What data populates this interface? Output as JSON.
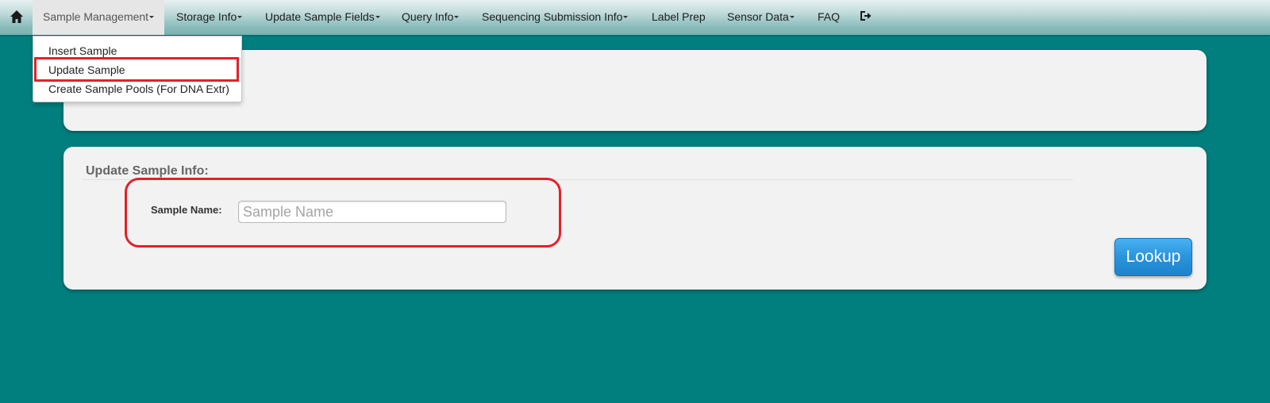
{
  "navbar": {
    "home_icon": "home-icon",
    "items": [
      {
        "label": "Sample Management",
        "has_caret": true,
        "active": true
      },
      {
        "label": "Storage Info",
        "has_caret": true
      },
      {
        "label": "Update Sample Fields",
        "has_caret": true
      },
      {
        "label": "Query Info",
        "has_caret": true
      },
      {
        "label": "Sequencing Submission Info",
        "has_caret": true
      },
      {
        "label": "Label Prep",
        "has_caret": false
      },
      {
        "label": "Sensor Data",
        "has_caret": true
      },
      {
        "label": "FAQ",
        "has_caret": false
      }
    ],
    "logout_icon": "logout-icon"
  },
  "dropdown": {
    "items": [
      {
        "label": "Insert Sample"
      },
      {
        "label": "Update Sample",
        "highlighted": true
      },
      {
        "label": "Create Sample Pools (For DNA Extr)"
      }
    ]
  },
  "update_panel": {
    "heading": "Update Sample Info:",
    "sample_name_label": "Sample Name:",
    "sample_name_value": "",
    "sample_name_placeholder": "Sample Name",
    "lookup_label": "Lookup"
  },
  "colors": {
    "background": "#017e7e",
    "panel": "#f2f2f2",
    "highlight": "#e4202a",
    "button": "#2a94dc"
  }
}
